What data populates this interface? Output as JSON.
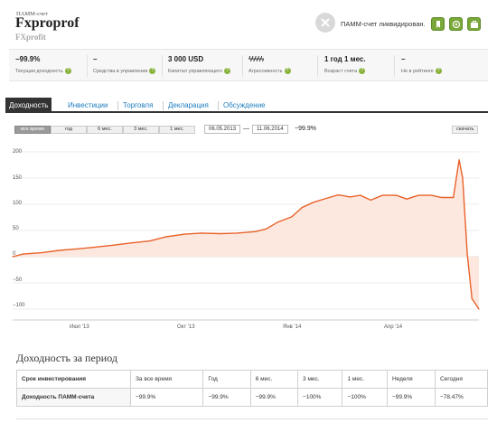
{
  "header": {
    "account_type": "ПАММ-счет",
    "account_name": "Fxproprof",
    "broker": "FXprofit",
    "liquidated_text": "ПАММ-счет ликвидирован."
  },
  "stats": [
    {
      "value": "−99.9%",
      "label": "Текущая доходность",
      "help": "?"
    },
    {
      "value": "–",
      "label": "Средства в управлении",
      "help": "?"
    },
    {
      "value": "3 000 USD",
      "label": "Капитал управляющего",
      "help": "?"
    },
    {
      "value": "ϟϟϟϟϟ",
      "label": "Агрессивность",
      "help": "?"
    },
    {
      "value": "1 год 1 мес.",
      "label": "Возраст счета",
      "help": "?"
    },
    {
      "value": "–",
      "label": "Не в рейтинге",
      "help": "?"
    }
  ],
  "tabs": [
    "Доходность",
    "Инвестиции",
    "Торговля",
    "Декларация",
    "Обсуждение"
  ],
  "periods": [
    "все время",
    "год",
    "6 мес.",
    "3 мес.",
    "1 мес."
  ],
  "date_from": "06.05.2013",
  "date_to": "11.06.2014",
  "range_separator": "—",
  "range_value": "−99.9%",
  "download_label": "скачать",
  "chart_data": {
    "type": "line",
    "ylim": [
      -100,
      200
    ],
    "y_ticks": [
      "200",
      "150",
      "100",
      "50",
      "0",
      "−50",
      "−100"
    ],
    "x_ticks": [
      "Июл '13",
      "Окт '13",
      "Янв '14",
      "Апр '14"
    ],
    "x": [
      "2013-05-06",
      "2013-05-15",
      "2013-06-01",
      "2013-06-15",
      "2013-07-01",
      "2013-07-15",
      "2013-08-01",
      "2013-08-15",
      "2013-09-01",
      "2013-09-15",
      "2013-10-01",
      "2013-10-15",
      "2013-11-01",
      "2013-11-15",
      "2013-12-01",
      "2013-12-10",
      "2013-12-20",
      "2014-01-01",
      "2014-01-10",
      "2014-01-20",
      "2014-02-01",
      "2014-02-10",
      "2014-02-20",
      "2014-03-01",
      "2014-03-10",
      "2014-03-20",
      "2014-04-01",
      "2014-04-10",
      "2014-04-20",
      "2014-05-01",
      "2014-05-10",
      "2014-05-20",
      "2014-05-25",
      "2014-05-28",
      "2014-06-01",
      "2014-06-05",
      "2014-06-11"
    ],
    "values": [
      0,
      5,
      8,
      12,
      15,
      18,
      22,
      26,
      30,
      38,
      43,
      45,
      44,
      45,
      48,
      53,
      66,
      76,
      94,
      104,
      112,
      118,
      114,
      117,
      108,
      117,
      117,
      110,
      117,
      117,
      113,
      113,
      185,
      150,
      5,
      -80,
      -100
    ],
    "line_color": "#e8622a",
    "fill_color": "#fde8df"
  },
  "period_section": {
    "title": "Доходность за период",
    "headers": [
      "Срок инвестирования",
      "За все время",
      "Год",
      "6 мес.",
      "3 мес.",
      "1 мес.",
      "Неделя",
      "Сегодня"
    ],
    "row": [
      "Доходность ПАММ-счета",
      "−99.9%",
      "−99.9%",
      "−99.9%",
      "−100%",
      "−100%",
      "−99.9%",
      "−78.47%"
    ]
  }
}
